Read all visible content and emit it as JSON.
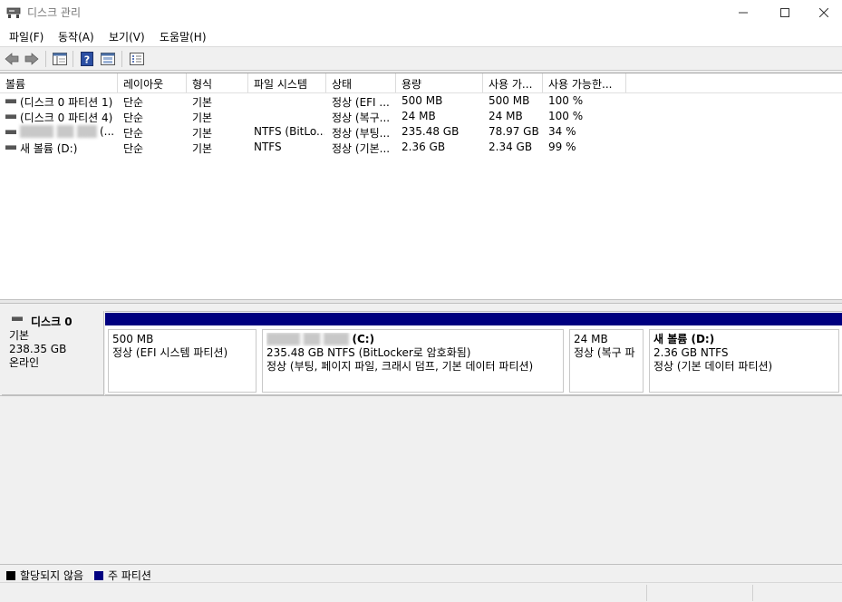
{
  "window": {
    "title": "디스크 관리",
    "min_glyph": "—",
    "max_glyph": "☐",
    "close_glyph": "✕"
  },
  "menu": [
    "파일(F)",
    "동작(A)",
    "보기(V)",
    "도움말(H)"
  ],
  "toolbar": {
    "icons": [
      "back-arrow-icon",
      "forward-arrow-icon",
      "console-tree-icon",
      "help-icon",
      "details-pane-icon",
      "properties-icon"
    ],
    "help_glyph": "?"
  },
  "columns": [
    "볼륨",
    "레이아웃",
    "형식",
    "파일 시스템",
    "상태",
    "용량",
    "사용 가...",
    "사용 가능한..."
  ],
  "volumes": [
    {
      "name": "(디스크 0 파티션 1)",
      "layout": "단순",
      "type": "기본",
      "fs": "",
      "status": "정상 (EFI ...",
      "capacity": "500 MB",
      "free": "500 MB",
      "pct": "100 %"
    },
    {
      "name": "(디스크 0 파티션 4)",
      "layout": "단순",
      "type": "기본",
      "fs": "",
      "status": "정상 (복구...",
      "capacity": "24 MB",
      "free": "24 MB",
      "pct": "100 %"
    },
    {
      "name": "████ ██ ███",
      "name_suffix": "(...",
      "layout": "단순",
      "type": "기본",
      "fs": "NTFS (BitLo...",
      "status": "정상 (부팅...",
      "capacity": "235.48 GB",
      "free": "78.97 GB",
      "pct": "34 %"
    },
    {
      "name": "새 볼륨 (D:)",
      "layout": "단순",
      "type": "기본",
      "fs": "NTFS",
      "status": "정상 (기본...",
      "capacity": "2.36 GB",
      "free": "2.34 GB",
      "pct": "99 %"
    }
  ],
  "disk": {
    "name": "디스크 0",
    "type": "기본",
    "size": "238.35 GB",
    "state": "온라인"
  },
  "partitions": [
    {
      "name": "",
      "size": "500 MB",
      "status": "정상 (EFI 시스템 파티션)"
    },
    {
      "name_blur": "████ ██ ███",
      "name": "(C:)",
      "size": "235.48 GB NTFS (BitLocker로 암호화됨)",
      "status": "정상 (부팅, 페이지 파일, 크래시 덤프, 기본 데이터 파티션)"
    },
    {
      "name": "",
      "size": "24 MB",
      "status": "정상 (복구 파"
    },
    {
      "name": "새 볼륨  (D:)",
      "size": "2.36 GB NTFS",
      "status": "정상 (기본 데이터 파티션)"
    }
  ],
  "legend": [
    {
      "label": "할당되지 않음",
      "color": "#000000"
    },
    {
      "label": "주 파티션",
      "color": "#000080"
    }
  ],
  "colors": {
    "primary_partition": "#000080",
    "unallocated": "#000000"
  }
}
